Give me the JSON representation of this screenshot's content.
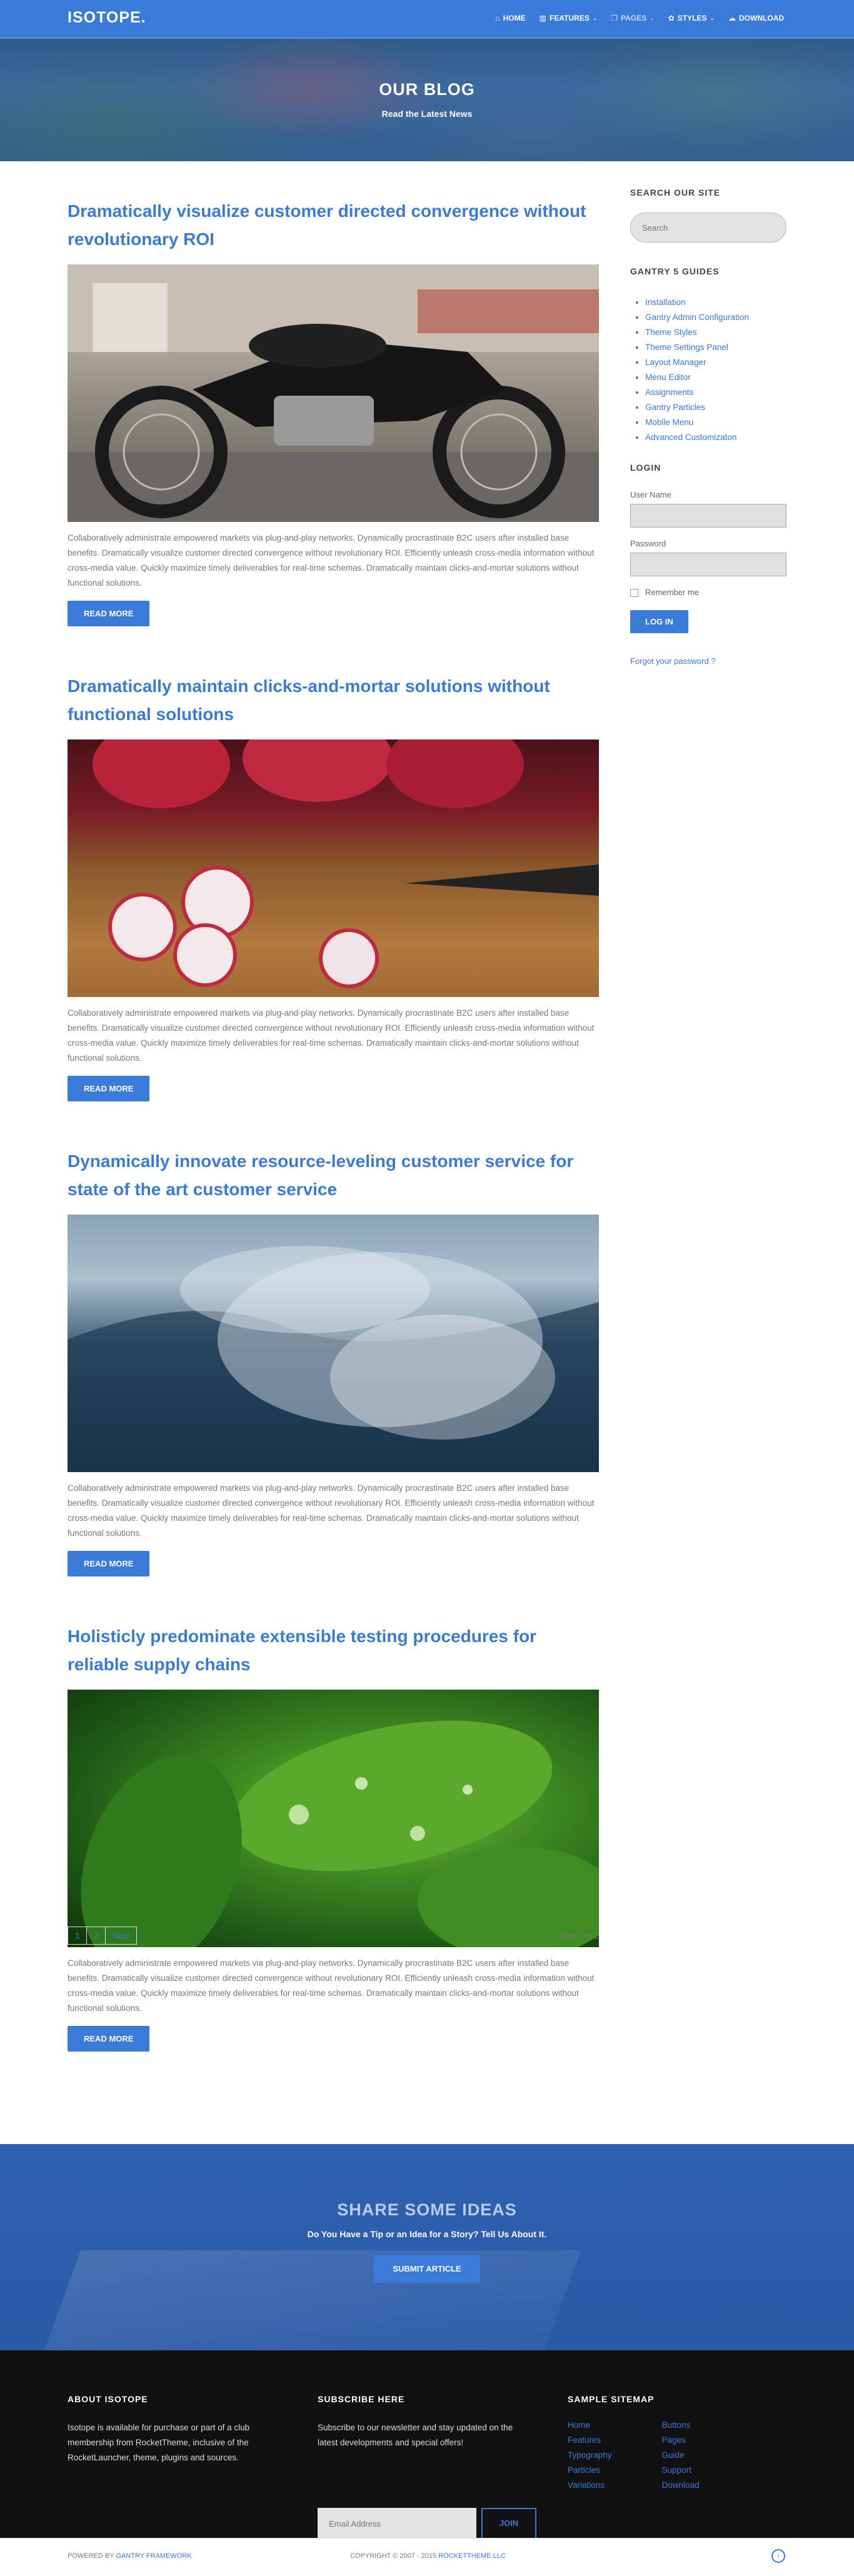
{
  "header": {
    "logo": "ISOTOPE.",
    "nav": [
      {
        "label": "Home",
        "icon": "home-icon"
      },
      {
        "label": "Features",
        "icon": "chart-icon"
      },
      {
        "label": "Pages",
        "icon": "pages-icon"
      },
      {
        "label": "Styles",
        "icon": "palette-icon"
      },
      {
        "label": "Download",
        "icon": "cloud-download-icon"
      }
    ]
  },
  "hero": {
    "title": "OUR BLOG",
    "subtitle": "Read the Latest News"
  },
  "posts": [
    {
      "title": "Dramatically visualize customer directed convergence without revolutionary ROI",
      "image": "motorcycle",
      "text": "Collaboratively administrate empowered markets via plug-and-play networks. Dynamically procrastinate B2C users after installed base benefits. Dramatically visualize customer directed convergence without revolutionary ROI. Efficiently unleash cross-media information without cross-media value. Quickly maximize timely deliverables for real-time schemas. Dramatically maintain clicks-and-mortar solutions without functional solutions.",
      "button": "Read More"
    },
    {
      "title": "Dramatically maintain clicks-and-mortar solutions without functional solutions",
      "image": "radishes",
      "text": "Collaboratively administrate empowered markets via plug-and-play networks. Dynamically procrastinate B2C users after installed base benefits. Dramatically visualize customer directed convergence without revolutionary ROI. Efficiently unleash cross-media information without cross-media value. Quickly maximize timely deliverables for real-time schemas. Dramatically maintain clicks-and-mortar solutions without functional solutions.",
      "button": "Read More"
    },
    {
      "title": "Dynamically innovate resource-leveling customer service for state of the art customer service",
      "image": "water-splash",
      "text": "Collaboratively administrate empowered markets via plug-and-play networks. Dynamically procrastinate B2C users after installed base benefits. Dramatically visualize customer directed convergence without revolutionary ROI. Efficiently unleash cross-media information without cross-media value. Quickly maximize timely deliverables for real-time schemas. Dramatically maintain clicks-and-mortar solutions without functional solutions.",
      "button": "Read More"
    },
    {
      "title": "Holisticly predominate extensible testing procedures for reliable supply chains",
      "image": "leaves",
      "text": "Collaboratively administrate empowered markets via plug-and-play networks. Dynamically procrastinate B2C users after installed base benefits. Dramatically visualize customer directed convergence without revolutionary ROI. Efficiently unleash cross-media information without cross-media value. Quickly maximize timely deliverables for real-time schemas. Dramatically maintain clicks-and-mortar solutions without functional solutions.",
      "button": "Read More"
    }
  ],
  "pagination": {
    "pages": [
      "1",
      "2",
      "Next"
    ],
    "count": "Page 1 of 2"
  },
  "sidebar": {
    "search_title": "Search Our Site",
    "search_placeholder": "Search",
    "guides_title": "Gantry 5 Guides",
    "guides": [
      "Installation",
      "Gantry Admin Configuration",
      "Theme Styles",
      "Theme Settings Panel",
      "Layout Manager",
      "Menu Editor",
      "Assignments",
      "Gantry Particles",
      "Mobile Menu",
      "Advanced Customizaton"
    ],
    "login_title": "Login",
    "username_label": "User Name",
    "password_label": "Password",
    "remember": "Remember me",
    "login_button": "LOG IN",
    "forgot": "Forgot your password ?"
  },
  "share": {
    "title": "SHARE SOME IDEAS",
    "subtitle": "Do You Have a Tip or an Idea for a Story? Tell Us About It.",
    "button": "Submit Article"
  },
  "footer": {
    "about_title": "About Isotope",
    "about_text": "Isotope is available for purchase or part of a club membership from RocketTheme, inclusive of the RocketLauncher, theme, plugins and sources.",
    "subscribe_title": "Subscribe Here",
    "subscribe_text": "Subscribe to our newsletter and stay updated on the latest developments and special offers!",
    "email_placeholder": "Email Address",
    "join": "JOIN",
    "sitemap_title": "Sample Sitemap",
    "sitemap_col1": [
      "Home",
      "Features",
      "Typography",
      "Particles",
      "Variations"
    ],
    "sitemap_col2": [
      "Buttons",
      "Pages",
      "Guide",
      "Support",
      "Download"
    ]
  },
  "bottombar": {
    "powered_prefix": "POWERED BY",
    "powered_link": "GANTRY FRAMEWORK",
    "copy_prefix": "COPYRIGHT © 2007 - 2015",
    "copy_link": "ROCKETTHEME LLC",
    "totop": "↑"
  },
  "colors": {
    "accent": "#3a7ad8",
    "footer_bg": "#111111"
  }
}
